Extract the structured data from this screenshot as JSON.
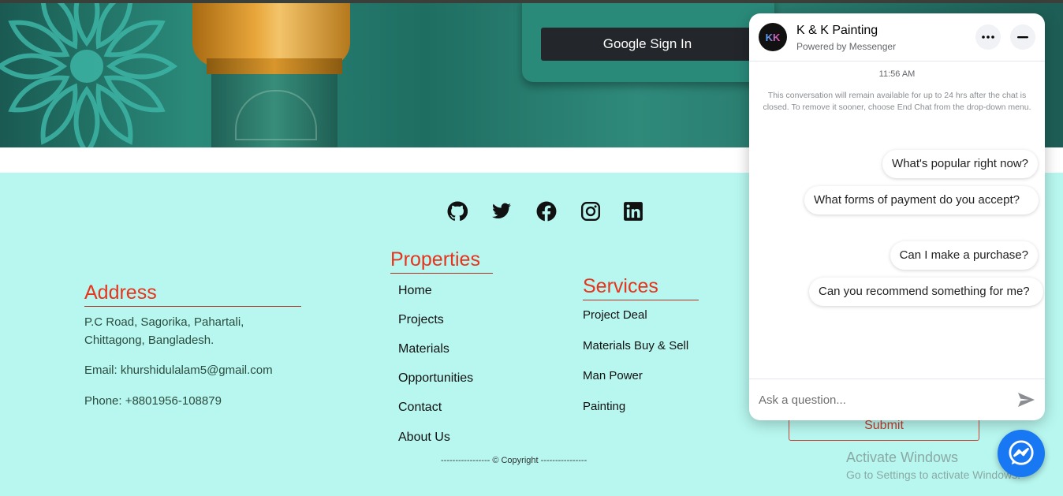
{
  "hero": {
    "google_button": "Google Sign In"
  },
  "social": {
    "icons": [
      "github-icon",
      "twitter-icon",
      "facebook-icon",
      "instagram-icon",
      "linkedin-icon"
    ]
  },
  "address": {
    "title": "Address",
    "line1": "P.C Road, Sagorika, Pahartali,",
    "line2": "Chittagong, Bangladesh.",
    "email": "Email: khurshidulalam5@gmail.com",
    "phone": "Phone: +8801956-108879"
  },
  "properties": {
    "title": "Properties",
    "links": [
      "Home",
      "Projects",
      "Materials",
      "Opportunities",
      "Contact",
      "About Us"
    ]
  },
  "services": {
    "title": "Services",
    "links": [
      "Project Deal",
      "Materials Buy & Sell",
      "Man Power",
      "Painting"
    ]
  },
  "copyright": "----------------- © Copyright ----------------",
  "form": {
    "submit_label": "Submit"
  },
  "watermark": {
    "line1": "Activate Windows",
    "line2": "Go to Settings to activate Windows."
  },
  "chat": {
    "avatar_text": "KK",
    "name": "K & K Painting",
    "subtitle": "Powered by Messenger",
    "time": "11:56 AM",
    "notice": "This conversation will remain available for up to 24 hrs after the chat is closed. To remove it sooner, choose End Chat from the drop-down menu.",
    "suggestions": [
      "What's popular right now?",
      "What forms of payment do you accept?",
      "Can I make a purchase?",
      "Can you recommend something for me?"
    ],
    "input_placeholder": "Ask a question..."
  },
  "colors": {
    "footer_bg": "#b7f7ef",
    "accent_red": "#e8341c",
    "messenger_blue": "#1877f2"
  }
}
